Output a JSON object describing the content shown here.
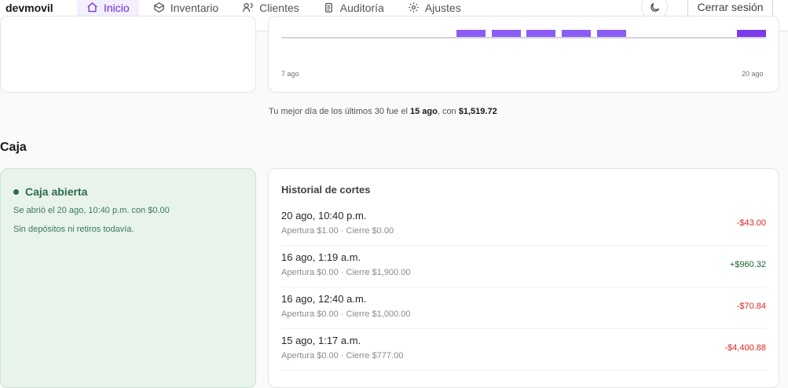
{
  "header": {
    "brand": "devmovil",
    "nav": [
      {
        "label": "Inicio",
        "icon": "home-icon",
        "active": true
      },
      {
        "label": "Inventario",
        "icon": "box-icon",
        "active": false
      },
      {
        "label": "Clientes",
        "icon": "users-icon",
        "active": false
      },
      {
        "label": "Auditoría",
        "icon": "clipboard-icon",
        "active": false
      },
      {
        "label": "Ajustes",
        "icon": "gear-icon",
        "active": false
      }
    ],
    "theme_toggle_icon": "moon-icon",
    "logout_label": "Cerrar sesión"
  },
  "chart": {
    "x_start_label": "7 ago",
    "x_end_label": "20 ago",
    "bar_color": "#8b5cf6"
  },
  "best_day": {
    "prefix": "Tu mejor día de los últimos 30 fue el",
    "date": "15 ago",
    "middle": ", con",
    "amount": "$1,519.72"
  },
  "caja": {
    "section_title": "Caja",
    "status": "Caja abierta",
    "opened_line": "Se abrió el 20 ago, 10:40 p.m. con $0.00",
    "movements_line": "Sin depósitos ni retiros todavía."
  },
  "history": {
    "title": "Historial de cortes",
    "rows": [
      {
        "date": "20 ago, 10:40 p.m.",
        "detail": "Apertura $1.00 · Cierre $0.00",
        "amount": "-$43.00"
      },
      {
        "date": "16 ago, 1:19 a.m.",
        "detail": "Apertura $0.00 · Cierre $1,900.00",
        "amount": "+$960.32"
      },
      {
        "date": "16 ago, 12:40 a.m.",
        "detail": "Apertura $0.00 · Cierre $1,000.00",
        "amount": "-$70.84"
      },
      {
        "date": "15 ago, 1:17 a.m.",
        "detail": "Apertura $0.00 · Cierre $777.00",
        "amount": "-$4,400.88"
      }
    ]
  },
  "colors": {
    "accent": "#6d28d9",
    "positive": "#166534",
    "negative": "#dc2626",
    "open_box_bg": "#e8f3ec"
  }
}
